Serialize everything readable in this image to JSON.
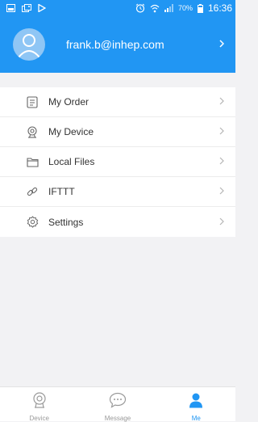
{
  "status_bar": {
    "battery": "70%",
    "time": "16:36"
  },
  "profile": {
    "email": "frank.b@inhep.com"
  },
  "menu": {
    "items": [
      {
        "label": "My Order",
        "icon": "order-icon"
      },
      {
        "label": "My Device",
        "icon": "camera-icon"
      },
      {
        "label": "Local Files",
        "icon": "folder-icon"
      },
      {
        "label": "IFTTT",
        "icon": "link-icon"
      },
      {
        "label": "Settings",
        "icon": "gear-icon"
      }
    ]
  },
  "tab_bar": {
    "tabs": [
      {
        "label": "Device",
        "icon": "camera-icon",
        "active": false
      },
      {
        "label": "Message",
        "icon": "chat-bubble-icon",
        "active": false
      },
      {
        "label": "Me",
        "icon": "person-icon",
        "active": true
      }
    ]
  },
  "colors": {
    "accent": "#2196f3",
    "background": "#f2f2f4",
    "inactive": "#9a9a9a"
  }
}
